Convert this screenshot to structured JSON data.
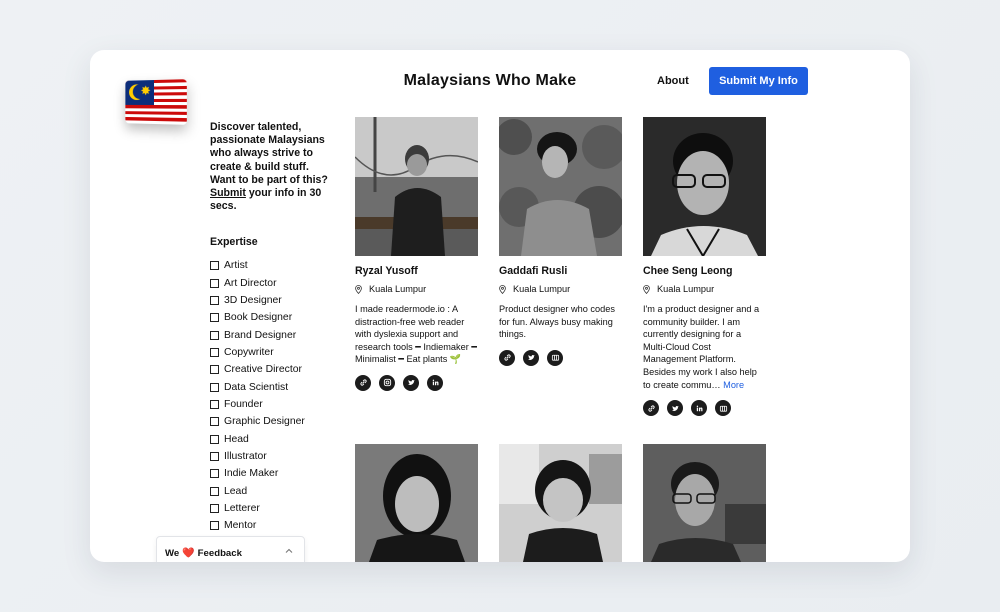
{
  "header": {
    "title": "Malaysians Who Make",
    "about_label": "About",
    "submit_label": "Submit My Info"
  },
  "sidebar": {
    "intro_before": "Discover talented, passionate Malaysians who always strive to create & build stuff. Want to be part of this? ",
    "intro_link": "Submit",
    "intro_after": " your info in 30 secs.",
    "expertise_heading": "Expertise",
    "expertise": [
      "Artist",
      "Art Director",
      "3D Designer",
      "Book Designer",
      "Brand Designer",
      "Copywriter",
      "Creative Director",
      "Data Scientist",
      "Founder",
      "Graphic Designer",
      "Head",
      "Illustrator",
      "Indie Maker",
      "Lead",
      "Letterer",
      "Mentor"
    ]
  },
  "feedback": {
    "prefix": "We",
    "heart": "❤️",
    "label": "Feedback"
  },
  "people": [
    {
      "name": "Ryzal Yusoff",
      "location": "Kuala Lumpur",
      "bio": "I made readermode.io : A distraction-free web reader with dyslexia support and research tools ━ Indiemaker ━ Minimalist ━ Eat plants 🌱",
      "more": "",
      "socials": [
        "link-icon",
        "instagram-icon",
        "twitter-icon",
        "linkedin-icon"
      ]
    },
    {
      "name": "Gaddafi Rusli",
      "location": "Kuala Lumpur",
      "bio": "Product designer who codes for fun. Always busy making things.",
      "more": "",
      "socials": [
        "link-icon",
        "twitter-icon",
        "portfolio-icon"
      ]
    },
    {
      "name": "Chee Seng Leong",
      "location": "Kuala Lumpur",
      "bio": "I'm a product designer and a community builder. I am currently designing for a Multi-Cloud Cost Management Platform. Besides my work I also help to create commu…",
      "more": "More",
      "socials": [
        "link-icon",
        "twitter-icon",
        "linkedin-icon",
        "portfolio-icon"
      ]
    }
  ]
}
